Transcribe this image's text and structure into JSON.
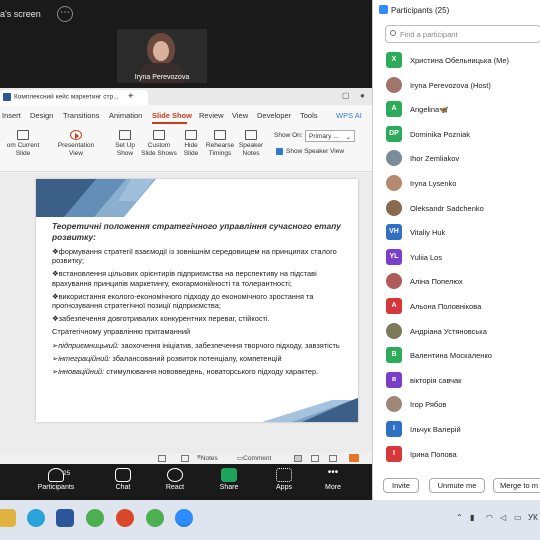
{
  "share": {
    "label": "a's screen"
  },
  "video": {
    "name": "Iryna Perevozova"
  },
  "wps": {
    "doc_tab": "Комплексний кейс маркетинг стр...",
    "menu": [
      "Insert",
      "Design",
      "Transitions",
      "Animation",
      "Slide Show",
      "Review",
      "View",
      "Developer",
      "Tools",
      "WPS AI"
    ],
    "ribbon": {
      "from_current": "om Current Slide",
      "presentation_view": "Presentation View",
      "setup_show": "Set Up Show",
      "custom_slide_shows": "Custom Slide Shows",
      "hide_slide": "Hide Slide",
      "rehearse_timings": "Rehearse Timings",
      "speaker_notes": "Speaker Notes",
      "show_on_label": "Show On:",
      "show_on_value": "Primary ...",
      "show_speaker_view": "Show Speaker View"
    },
    "slide": {
      "title": "Теоретичні положення стратегічного управління сучасного етапу розвитку:",
      "bullets": [
        "❖формування стратегії взаємодії із зовнішнім середовищем на принципах сталого розвитку;",
        "❖встановлення цільових орієнтирів підприємства на перспективу на підставі врахування принципів маркетингу, екогармонійності та толерантності;",
        "❖використання еколого-економічного підходу до економічного зростання та прогнозування стратегічної позиції підприємства;",
        "❖забезпечення довготривалих конкурентних переваг, стійкості."
      ],
      "subhead": "Стратегічному управлінню притаманний",
      "types": [
        {
          "term": "підприємницький:",
          "text": " заохочення ініціатив, забезпечення творчого підходу, завзятість"
        },
        {
          "term": "інтеграційний:",
          "text": " збалансований розвиток потенціалу, компетенцій"
        },
        {
          "term": "інноваційний:",
          "text": " стимулювання нововведень, новаторського підходу характер."
        }
      ]
    },
    "status": {
      "notes": "Notes",
      "comment": "Comment"
    }
  },
  "zoom_bar": {
    "participants_label": "Participants",
    "participants_count": "25",
    "chat": "Chat",
    "react": "React",
    "share": "Share",
    "apps": "Apps",
    "more": "More"
  },
  "participants_panel": {
    "title": "Participants (25)",
    "search_placeholder": "Find a participant",
    "people": [
      {
        "initials": "X",
        "name": "Христина Обельницька (Me)",
        "color": "#2eab5a",
        "photo": false
      },
      {
        "initials": "",
        "name": "Iryna Perevozova (Host)",
        "color": "#a0766b",
        "photo": true
      },
      {
        "initials": "A",
        "name": "Angelina🦋",
        "color": "#2eab5a",
        "photo": false
      },
      {
        "initials": "DP",
        "name": "Dominika Pozniak",
        "color": "#2eab5a",
        "photo": false
      },
      {
        "initials": "",
        "name": "Ihor Zemliakov",
        "color": "#7a8c9a",
        "photo": true
      },
      {
        "initials": "",
        "name": "Iryna Lysenko",
        "color": "#b58a6e",
        "photo": true
      },
      {
        "initials": "",
        "name": "Oleksandr Sadchenko",
        "color": "#8a6a4f",
        "photo": true
      },
      {
        "initials": "VH",
        "name": "Vitaliy Huk",
        "color": "#2f6fc4",
        "photo": false
      },
      {
        "initials": "YL",
        "name": "Yuliia Los",
        "color": "#7a3fc9",
        "photo": false
      },
      {
        "initials": "",
        "name": "Аліна Попелюх",
        "color": "#b05a5a",
        "photo": true
      },
      {
        "initials": "A",
        "name": "Альона Половнікова",
        "color": "#d4383a",
        "photo": false
      },
      {
        "initials": "",
        "name": "Андріана Устяновська",
        "color": "#7a7a5a",
        "photo": true
      },
      {
        "initials": "B",
        "name": "Валентина Москаленко",
        "color": "#2eab5a",
        "photo": false
      },
      {
        "initials": "в",
        "name": "вікторія савчак",
        "color": "#7a3fc9",
        "photo": false
      },
      {
        "initials": "",
        "name": "Ігор Рябов",
        "color": "#a08878",
        "photo": true
      },
      {
        "initials": "І",
        "name": "Ільчук Валерій",
        "color": "#2f6fc4",
        "photo": false
      },
      {
        "initials": "І",
        "name": "Ірина Попова",
        "color": "#d4383a",
        "photo": false
      }
    ],
    "invite": "Invite",
    "unmute": "Unmute me",
    "merge": "Merge to m"
  },
  "taskbar": {
    "lang": "УК"
  }
}
